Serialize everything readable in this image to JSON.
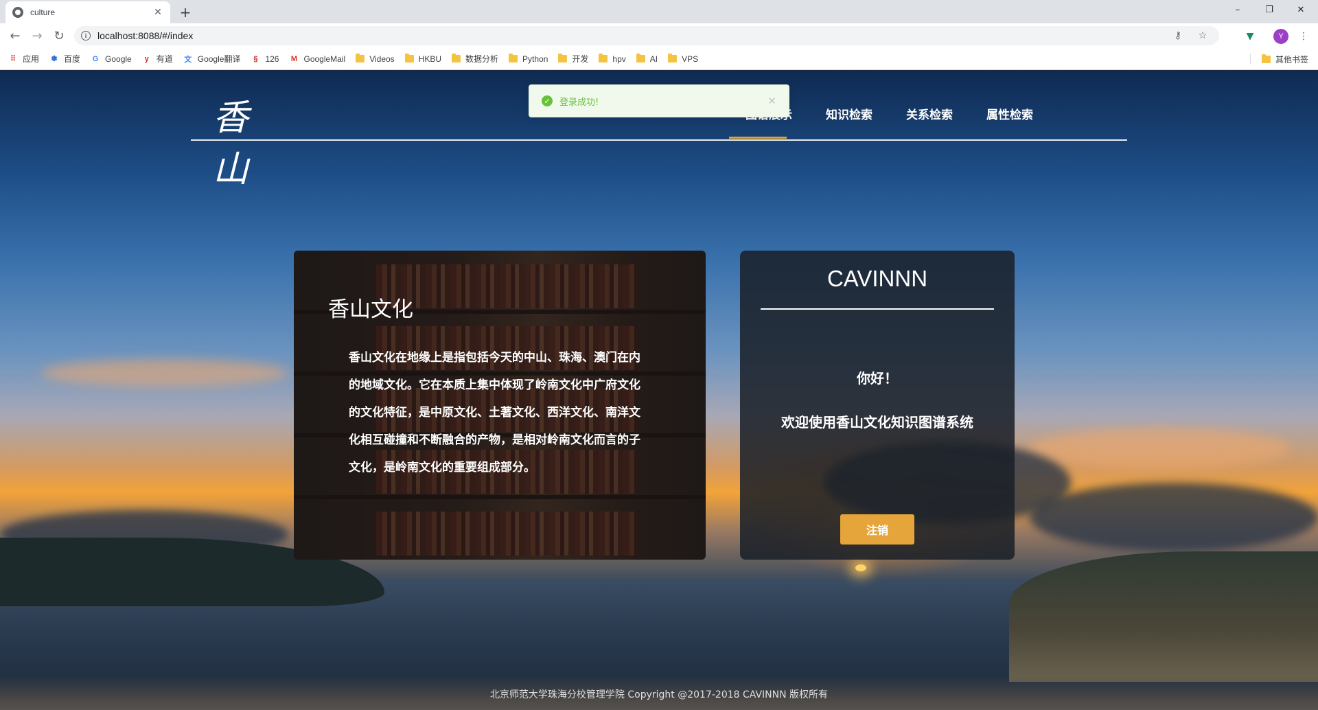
{
  "browser": {
    "tab_title": "culture",
    "url": "localhost:8088/#/index",
    "avatar_letter": "Y",
    "window_controls": {
      "minimize": "–",
      "restore": "❐",
      "close": "✕"
    }
  },
  "bookmarks": {
    "items": [
      {
        "label": "应用",
        "icon": "apps-grid-icon"
      },
      {
        "label": "百度",
        "icon": "baidu-paw-icon"
      },
      {
        "label": "Google",
        "icon": "google-g-icon"
      },
      {
        "label": "有道",
        "icon": "youdao-y-icon"
      },
      {
        "label": "Google翻译",
        "icon": "google-translate-icon"
      },
      {
        "label": "126",
        "icon": "126-mail-icon"
      },
      {
        "label": "GoogleMail",
        "icon": "gmail-m-icon"
      },
      {
        "label": "Videos",
        "icon": "folder-icon"
      },
      {
        "label": "HKBU",
        "icon": "folder-icon"
      },
      {
        "label": "数据分析",
        "icon": "folder-icon"
      },
      {
        "label": "Python",
        "icon": "folder-icon"
      },
      {
        "label": "开发",
        "icon": "folder-icon"
      },
      {
        "label": "hpv",
        "icon": "folder-icon"
      },
      {
        "label": "AI",
        "icon": "folder-icon"
      },
      {
        "label": "VPS",
        "icon": "folder-icon"
      }
    ],
    "other": "其他书签"
  },
  "site": {
    "logo_text": "香山",
    "nav": [
      "图谱展示",
      "知识检索",
      "关系检索",
      "属性检索"
    ],
    "toast": "登录成功!"
  },
  "culture_card": {
    "title": "香山文化",
    "body": "香山文化在地缘上是指包括今天的中山、珠海、澳门在内的地域文化。它在本质上集中体现了岭南文化中广府文化的文化特征，是中原文化、土著文化、西洋文化、南洋文化相互碰撞和不断融合的产物，是相对岭南文化而言的子文化，是岭南文化的重要组成部分。"
  },
  "user_card": {
    "username": "CAVINNN",
    "greeting": "你好！",
    "welcome": "欢迎使用香山文化知识图谱系统",
    "logout": "注销"
  },
  "footer": "北京师范大学珠海分校管理学院 Copyright @2017-2018 CAVINNN 版权所有",
  "colors": {
    "accent": "#e5a53a",
    "toast_success": "#67c23a",
    "nav_active": "#d8a33a"
  }
}
